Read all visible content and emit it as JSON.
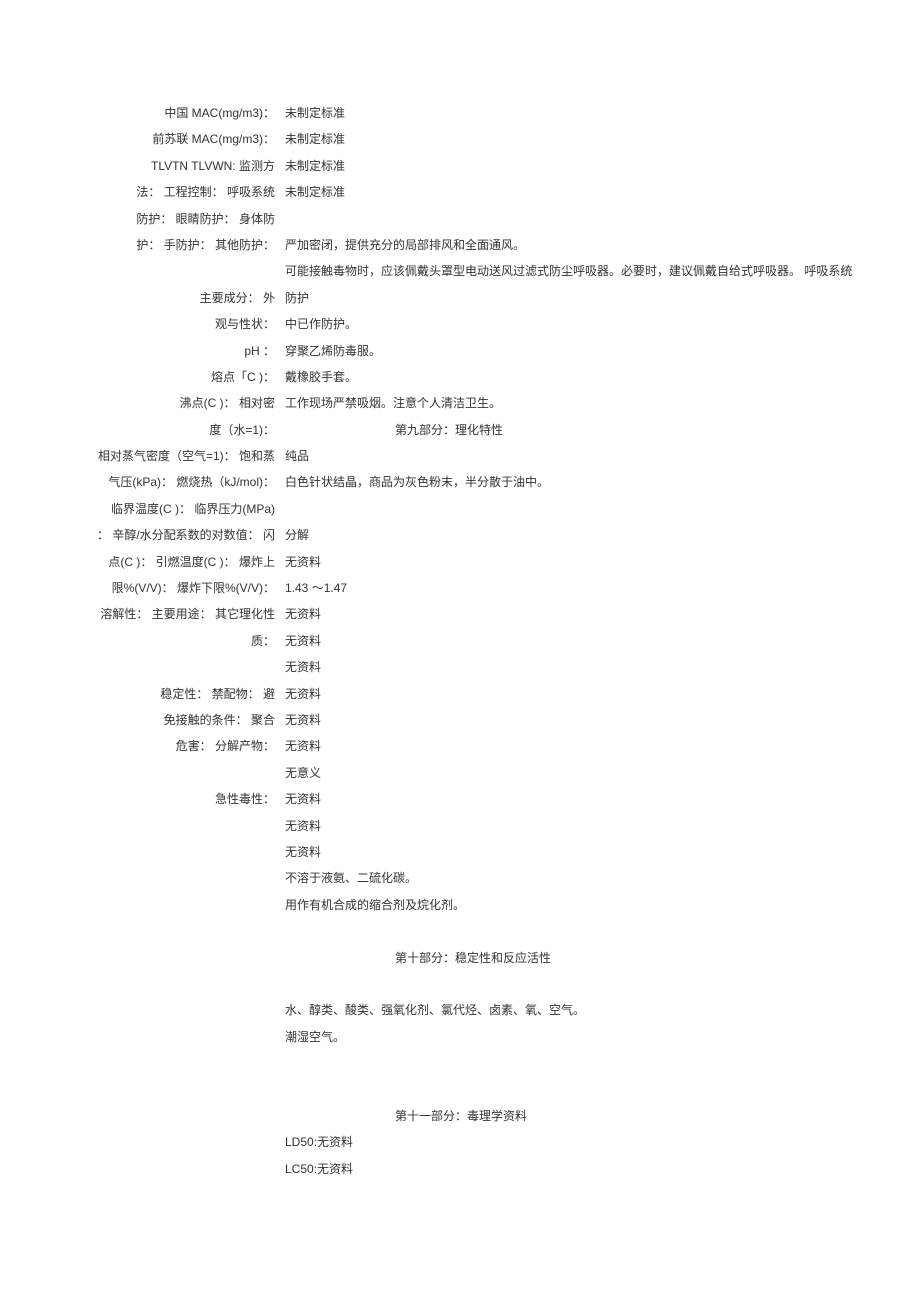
{
  "left": {
    "l1": "中国 MAC(mg/m3)：",
    "l2": "前苏联 MAC(mg/m3)：",
    "l3": "TLVTN TLVWN: 监测方",
    "l4": "法： 工程控制： 呼吸系统",
    "l5": "防护： 眼睛防护： 身体防",
    "l6": "护： 手防护： 其他防护：",
    "l7": "主要成分：  外",
    "l8": "观与性状：",
    "l9": "pH ：",
    "l10": "熔点「C )：",
    "l11": "沸点(C )： 相对密",
    "l12": "度（水=1)：",
    "l13": "相对蒸气密度（空气=1)：  饱和蒸",
    "l14": "气压(kPa)：  燃烧热（kJ/mol)：",
    "l15": "临界温度(C )：  临界压力(MPa)",
    "l16": "：  辛醇/水分配系数的对数值：  闪",
    "l17": "点(C )：  引燃温度(C )：  爆炸上",
    "l18": "限%(V/V)：  爆炸下限%(V/V)：",
    "l19": "溶解性：  主要用途：  其它理化性",
    "l20": "质：",
    "l21": "稳定性：  禁配物：  避",
    "l22": "免接触的条件：  聚合",
    "l23": "危害：  分解产物：",
    "l24": "急性毒性："
  },
  "right": {
    "r1": "未制定标准",
    "r2": "未制定标准",
    "r3": "未制定标准",
    "r4": "未制定标准",
    "r5": "严加密闭，提供充分的局部排风和全面通风。",
    "r6": "可能接触毒物时，应该佩戴头罩型电动送风过滤式防尘呼吸器。必要时，建议佩戴自给式呼吸器。  呼吸系统防护",
    "r7": "中已作防护。",
    "r8": "穿聚乙烯防毒服。",
    "r9": "戴橡胶手套。",
    "r10": "工作现场严禁吸烟。注意个人清洁卫生。",
    "section9": "第九部分：理化特性",
    "r11": "纯品",
    "r12": "白色针状结晶，商品为灰色粉末，半分散于油中。",
    "r13": "分解",
    "r14": "无资料",
    "r15": "1.43 ～1.47",
    "r16": "无资料",
    "r17": "无资料",
    "r18": "无资料",
    "r19": "无资料",
    "r20": "无资料",
    "r21": "无资料",
    "r22": "无意义",
    "r23": "无资料",
    "r24": "无资料",
    "r25": "无资料",
    "r26": "不溶于液氨、二硫化碳。",
    "r27": "用作有机合成的缩合剂及烷化剂。",
    "section10": "第十部分：稳定性和反应活性",
    "r28": "水、醇类、酸类、强氧化剂、氯代烃、卤素、氧、空气。",
    "r29": "潮湿空气。",
    "section11": "第十一部分：毒理学资料",
    "r30": "LD50:无资料",
    "r31": "LC50:无资料"
  }
}
